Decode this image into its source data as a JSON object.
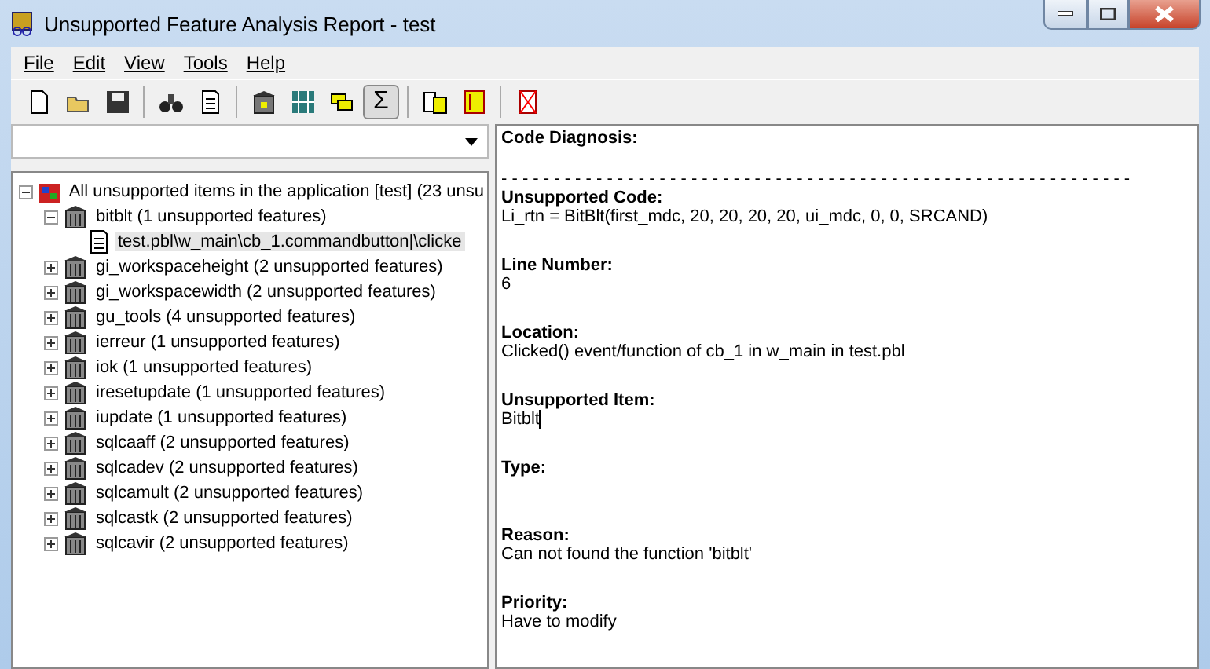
{
  "window": {
    "title": "Unsupported Feature Analysis Report - test"
  },
  "menu": [
    "File",
    "Edit",
    "View",
    "Tools",
    "Help"
  ],
  "toolbar": [
    {
      "pressed": false
    },
    {
      "pressed": false
    },
    {
      "pressed": false
    },
    {
      "pressed": false
    },
    {
      "pressed": false
    },
    {
      "pressed": false
    },
    {
      "pressed": false
    },
    {
      "pressed": false
    },
    {
      "pressed": true,
      "label": "Σ"
    },
    {
      "pressed": false
    },
    {
      "pressed": false
    },
    {
      "pressed": false
    }
  ],
  "tree": {
    "label": "All unsupported items in the application [test] (23 unsu",
    "expanded": true,
    "children": [
      {
        "label": "bitblt (1 unsupported features)",
        "expanded": true,
        "children": [
          {
            "label": "test.pbl\\w_main\\cb_1.commandbutton|\\clicke",
            "selected": true
          }
        ]
      },
      {
        "label": "gi_workspaceheight (2 unsupported features)",
        "expanded": false
      },
      {
        "label": "gi_workspacewidth (2 unsupported features)",
        "expanded": false
      },
      {
        "label": "gu_tools (4 unsupported features)",
        "expanded": false
      },
      {
        "label": "ierreur (1 unsupported features)",
        "expanded": false
      },
      {
        "label": "iok (1 unsupported features)",
        "expanded": false
      },
      {
        "label": "iresetupdate (1 unsupported features)",
        "expanded": false
      },
      {
        "label": "iupdate (1 unsupported features)",
        "expanded": false
      },
      {
        "label": "sqlcaaff (2 unsupported features)",
        "expanded": false
      },
      {
        "label": "sqlcadev (2 unsupported features)",
        "expanded": false
      },
      {
        "label": "sqlcamult (2 unsupported features)",
        "expanded": false
      },
      {
        "label": "sqlcastk (2 unsupported features)",
        "expanded": false
      },
      {
        "label": "sqlcavir (2 unsupported features)",
        "expanded": false
      }
    ]
  },
  "report": {
    "title": "Code Diagnosis:",
    "separator": "- - - - - - - - - - - - - - - - - - - - - - - - - - - - - - - - - - - - - - - - - - - - - - - - - - - - - - - - - - - -",
    "sections": [
      {
        "heading": "Unsupported Code:",
        "value": "Li_rtn = BitBlt(first_mdc, 20, 20, 20, 20, ui_mdc, 0, 0, SRCAND)"
      },
      {
        "heading": "Line Number:",
        "value": "6"
      },
      {
        "heading": "Location:",
        "value": "Clicked() event/function of cb_1 in w_main in test.pbl"
      },
      {
        "heading": "Unsupported Item:",
        "value": "Bitblt",
        "cursor": true
      },
      {
        "heading": "Type:"
      },
      {
        "heading": "Reason:",
        "value": "Can not found the function 'bitblt'"
      },
      {
        "heading": "Priority:",
        "value": "Have to modify"
      }
    ]
  }
}
